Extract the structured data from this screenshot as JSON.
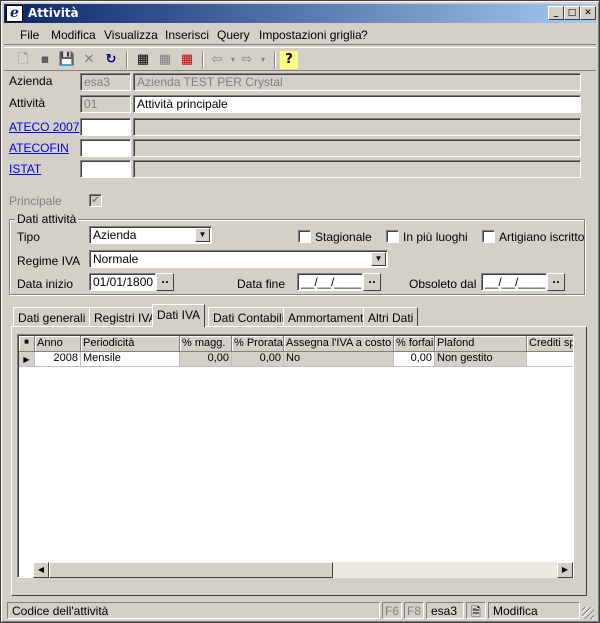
{
  "window": {
    "title": "Attività"
  },
  "menu": [
    "File",
    "Modifica",
    "Visualizza",
    "Inserisci",
    "Query",
    "Impostazioni griglia",
    "?"
  ],
  "form": {
    "azienda": {
      "label": "Azienda",
      "code": "esa3",
      "desc": "Azienda TEST PER Crystal"
    },
    "attivita": {
      "label": "Attività",
      "code": "01",
      "desc": "Attività principale"
    },
    "ateco": {
      "label": "ATECO 2007",
      "code": "",
      "desc": ""
    },
    "atecofin": {
      "label": "ATECOFIN",
      "code": "",
      "desc": ""
    },
    "istat": {
      "label": "ISTAT",
      "code": "",
      "desc": ""
    },
    "principale": {
      "label": "Principale",
      "checked": true
    }
  },
  "dati_attivita": {
    "title": "Dati attività",
    "tipo_label": "Tipo",
    "tipo_value": "Azienda",
    "stagionale": "Stagionale",
    "piu_luoghi": "In più luoghi",
    "artigiano": "Artigiano iscritto",
    "regime_label": "Regime IVA",
    "regime_value": "Normale",
    "data_inizio_label": "Data inizio",
    "data_inizio": "01/01/1800",
    "data_fine_label": "Data fine",
    "data_fine": "__/__/____",
    "obsoleto_label": "Obsoleto dal",
    "obsoleto": "__/__/____",
    "dots": ".."
  },
  "tabs": [
    "Dati generali",
    "Registri IVA",
    "Dati IVA",
    "Dati Contabili",
    "Ammortamenti",
    "Altri Dati"
  ],
  "active_tab": 2,
  "grid": {
    "corner": "■",
    "columns": [
      "Anno",
      "Periodicità",
      "% magg.",
      "% Prorata",
      "Assegna l'IVA a costo",
      "% forfai",
      "Plafond",
      "Crediti sp"
    ],
    "row": [
      "2008",
      "Mensile",
      "0,00",
      "0,00",
      "No",
      "0,00",
      "Non gestito",
      ""
    ]
  },
  "status": {
    "text": "Codice dell'attività",
    "f6": "F6",
    "f8": "F8",
    "company": "esa3",
    "mode": "Modifica"
  }
}
